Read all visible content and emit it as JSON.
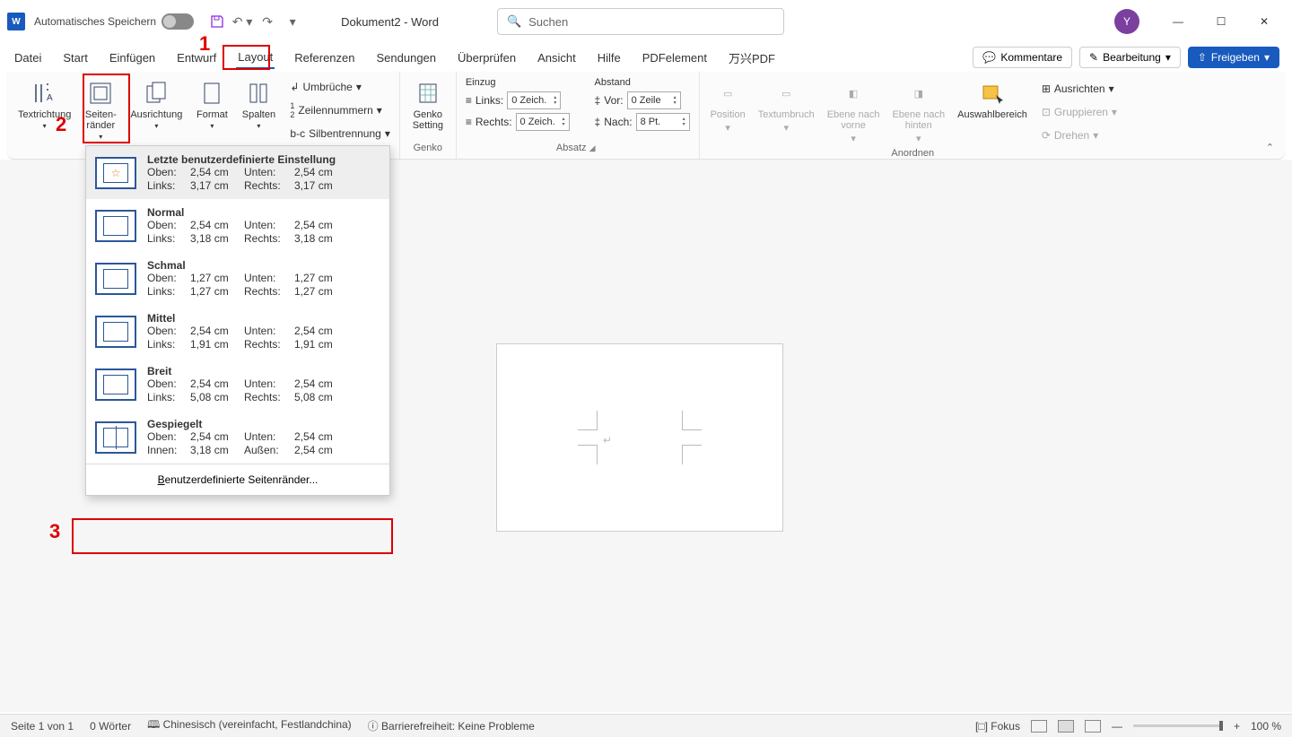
{
  "title": {
    "autosave": "Automatisches Speichern",
    "doc": "Dokument2  -  Word",
    "search": "Suchen",
    "avatar": "Y"
  },
  "tabs": {
    "file": "Datei",
    "home": "Start",
    "insert": "Einfügen",
    "design": "Entwurf",
    "layout": "Layout",
    "references": "Referenzen",
    "mailings": "Sendungen",
    "review": "Überprüfen",
    "view": "Ansicht",
    "help": "Hilfe",
    "pdfelement": "PDFelement",
    "wanxing": "万兴PDF"
  },
  "tabbtn": {
    "comments": "Kommentare",
    "editing": "Bearbeitung",
    "share": "Freigeben"
  },
  "ribbon": {
    "textdir": "Textrichtung",
    "margins": "Seiten-\nränder",
    "orientation": "Ausrichtung",
    "format": "Format",
    "columns": "Spalten",
    "breaks": "Umbrüche",
    "linenums": "Zeilennummern",
    "hyphen": "Silbentrennung",
    "genko": "Genko\nSetting",
    "genko_grp": "Genko",
    "indent_grp": "Einzug",
    "left": "Links:",
    "right": "Rechts:",
    "left_val": "0 Zeich.",
    "right_val": "0 Zeich.",
    "spacing_grp": "Abstand",
    "before": "Vor:",
    "after": "Nach:",
    "before_val": "0 Zeile",
    "after_val": "8 Pt.",
    "abs_grp": "Absatz",
    "position": "Position",
    "wrap": "Textumbruch",
    "fwd": "Ebene nach\nvorne",
    "back": "Ebene nach\nhinten",
    "select": "Auswahlbereich",
    "align": "Ausrichten",
    "group": "Gruppieren",
    "rotate": "Drehen",
    "arrange_grp": "Anordnen"
  },
  "margins_menu": {
    "last": {
      "title": "Letzte benutzerdefinierte Einstellung",
      "top_l": "Oben:",
      "top_v": "2,54 cm",
      "bot_l": "Unten:",
      "bot_v": "2,54 cm",
      "left_l": "Links:",
      "left_v": "3,17 cm",
      "right_l": "Rechts:",
      "right_v": "3,17 cm"
    },
    "normal": {
      "title": "Normal",
      "top_l": "Oben:",
      "top_v": "2,54 cm",
      "bot_l": "Unten:",
      "bot_v": "2,54 cm",
      "left_l": "Links:",
      "left_v": "3,18 cm",
      "right_l": "Rechts:",
      "right_v": "3,18 cm"
    },
    "narrow": {
      "title": "Schmal",
      "top_l": "Oben:",
      "top_v": "1,27 cm",
      "bot_l": "Unten:",
      "bot_v": "1,27 cm",
      "left_l": "Links:",
      "left_v": "1,27 cm",
      "right_l": "Rechts:",
      "right_v": "1,27 cm"
    },
    "medium": {
      "title": "Mittel",
      "top_l": "Oben:",
      "top_v": "2,54 cm",
      "bot_l": "Unten:",
      "bot_v": "2,54 cm",
      "left_l": "Links:",
      "left_v": "1,91 cm",
      "right_l": "Rechts:",
      "right_v": "1,91 cm"
    },
    "wide": {
      "title": "Breit",
      "top_l": "Oben:",
      "top_v": "2,54 cm",
      "bot_l": "Unten:",
      "bot_v": "2,54 cm",
      "left_l": "Links:",
      "left_v": "5,08 cm",
      "right_l": "Rechts:",
      "right_v": "5,08 cm"
    },
    "mirrored": {
      "title": "Gespiegelt",
      "top_l": "Oben:",
      "top_v": "2,54 cm",
      "bot_l": "Unten:",
      "bot_v": "2,54 cm",
      "left_l": "Innen:",
      "left_v": "3,18 cm",
      "right_l": "Außen:",
      "right_v": "2,54 cm"
    },
    "custom_pre": "B",
    "custom_post": "enutzerdefinierte Seitenränder..."
  },
  "anno": {
    "one": "1",
    "two": "2",
    "three": "3"
  },
  "status": {
    "page": "Seite 1 von 1",
    "words": "0 Wörter",
    "lang": "Chinesisch (vereinfacht, Festlandchina)",
    "access": "Barrierefreiheit: Keine Probleme",
    "focus": "Fokus",
    "zoom": "100 %"
  }
}
